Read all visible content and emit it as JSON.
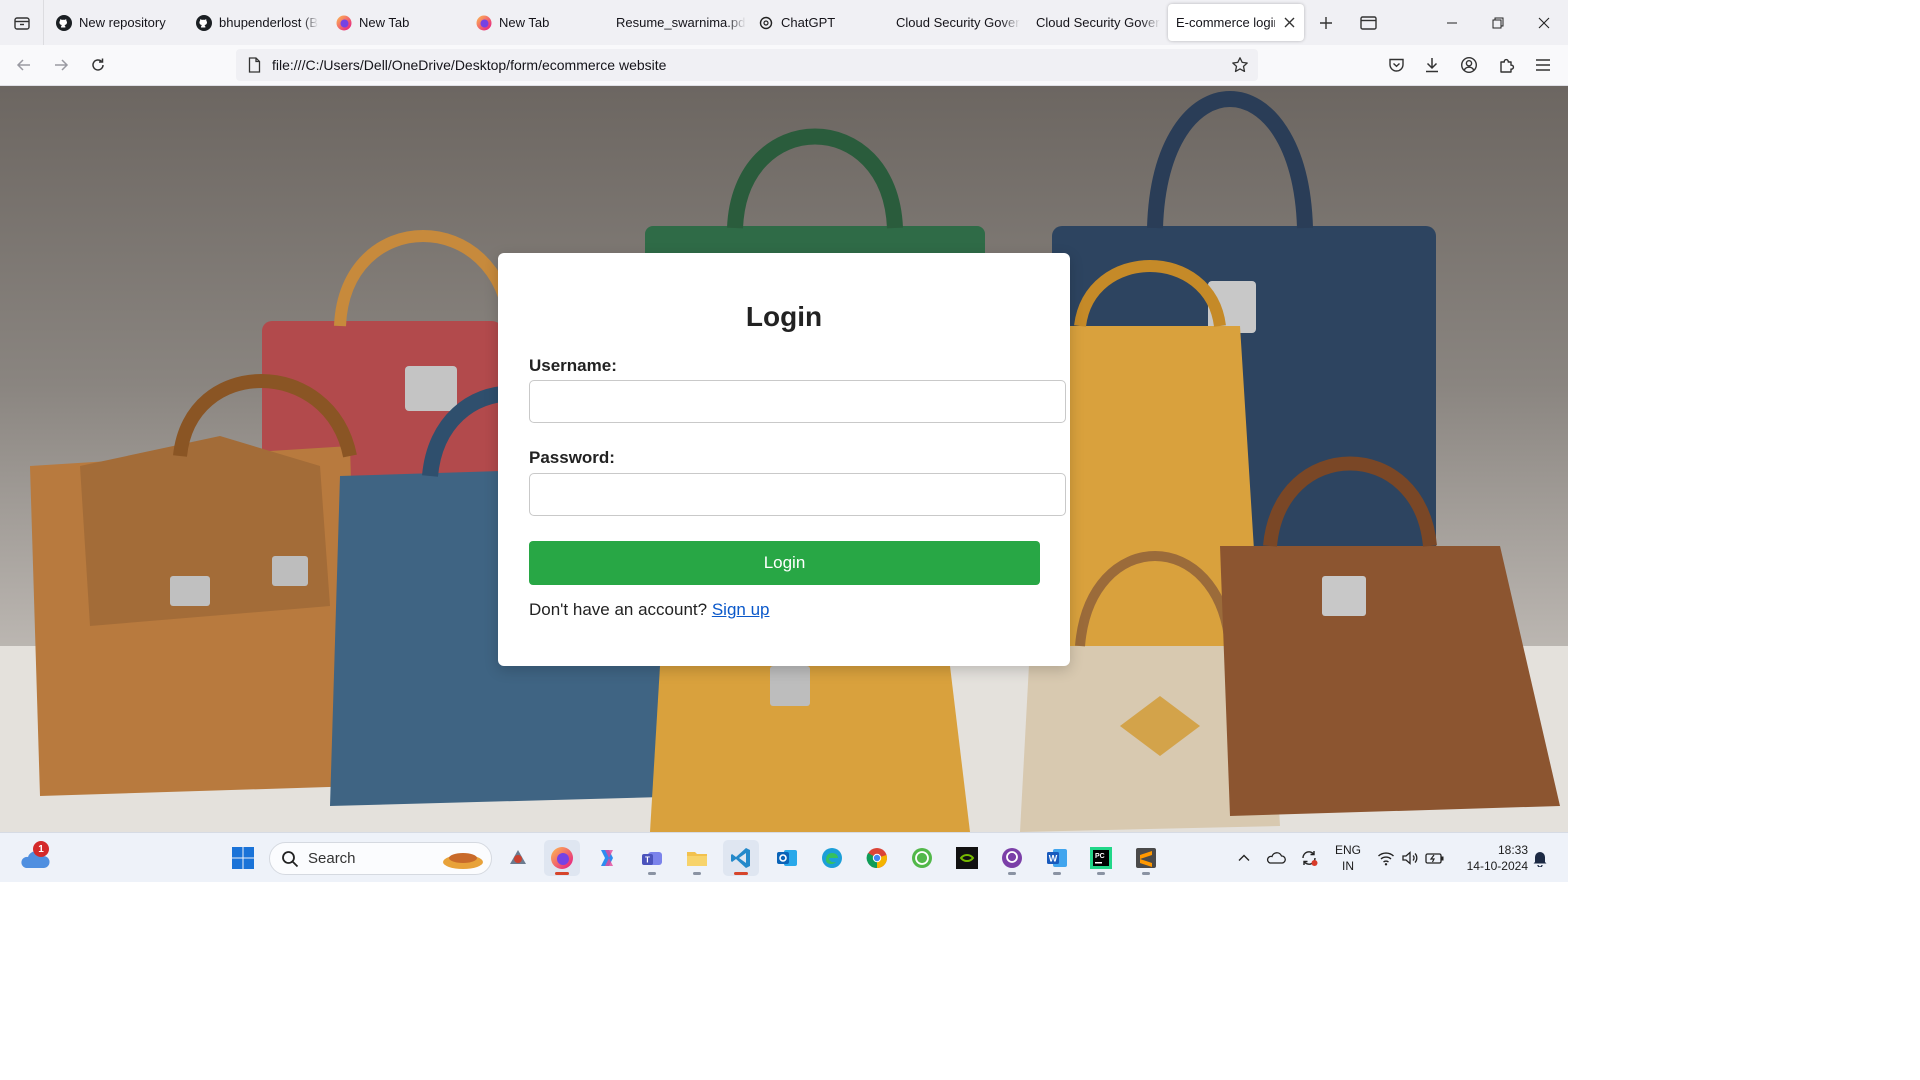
{
  "browser": {
    "tabs": [
      {
        "title": "New repository",
        "icon": "github-icon"
      },
      {
        "title": "bhupenderlost (Bhupender)",
        "icon": "github-icon"
      },
      {
        "title": "New Tab",
        "icon": "firefox-icon"
      },
      {
        "title": "New Tab",
        "icon": "firefox-icon"
      },
      {
        "title": "Resume_swarnima.pdf",
        "icon": "pdf-icon"
      },
      {
        "title": "ChatGPT",
        "icon": "chatgpt-icon"
      },
      {
        "title": "Cloud Security Governance",
        "icon": "page-icon"
      },
      {
        "title": "Cloud Security Governance",
        "icon": "page-icon"
      },
      {
        "title": "E-commerce login",
        "icon": "page-icon",
        "active": true
      }
    ],
    "url": "file:///C:/Users/Dell/OneDrive/Desktop/form/ecommerce website"
  },
  "login": {
    "title": "Login",
    "username_label": "Username:",
    "username_value": "",
    "password_label": "Password:",
    "password_value": "",
    "button_label": "Login",
    "signup_prompt": "Don't have an account?",
    "signup_link": "Sign up"
  },
  "taskbar": {
    "weather_badge": "1",
    "search_placeholder": "Search",
    "apps": [
      "copilot-icon",
      "firefox-icon",
      "copilot-app-icon",
      "teams-icon",
      "file-explorer-icon",
      "vscode-icon",
      "outlook-icon",
      "edge-icon",
      "chrome-icon",
      "whatsapp-icon",
      "nvidia-icon",
      "github-desktop-icon",
      "word-icon",
      "pycharm-icon",
      "sublime-text-icon"
    ],
    "language_line1": "ENG",
    "language_line2": "IN",
    "time": "18:33",
    "date": "14-10-2024"
  },
  "colors": {
    "accent": "#28a745",
    "link": "#0a58ca",
    "chrome_bg": "#f0f0f4"
  }
}
